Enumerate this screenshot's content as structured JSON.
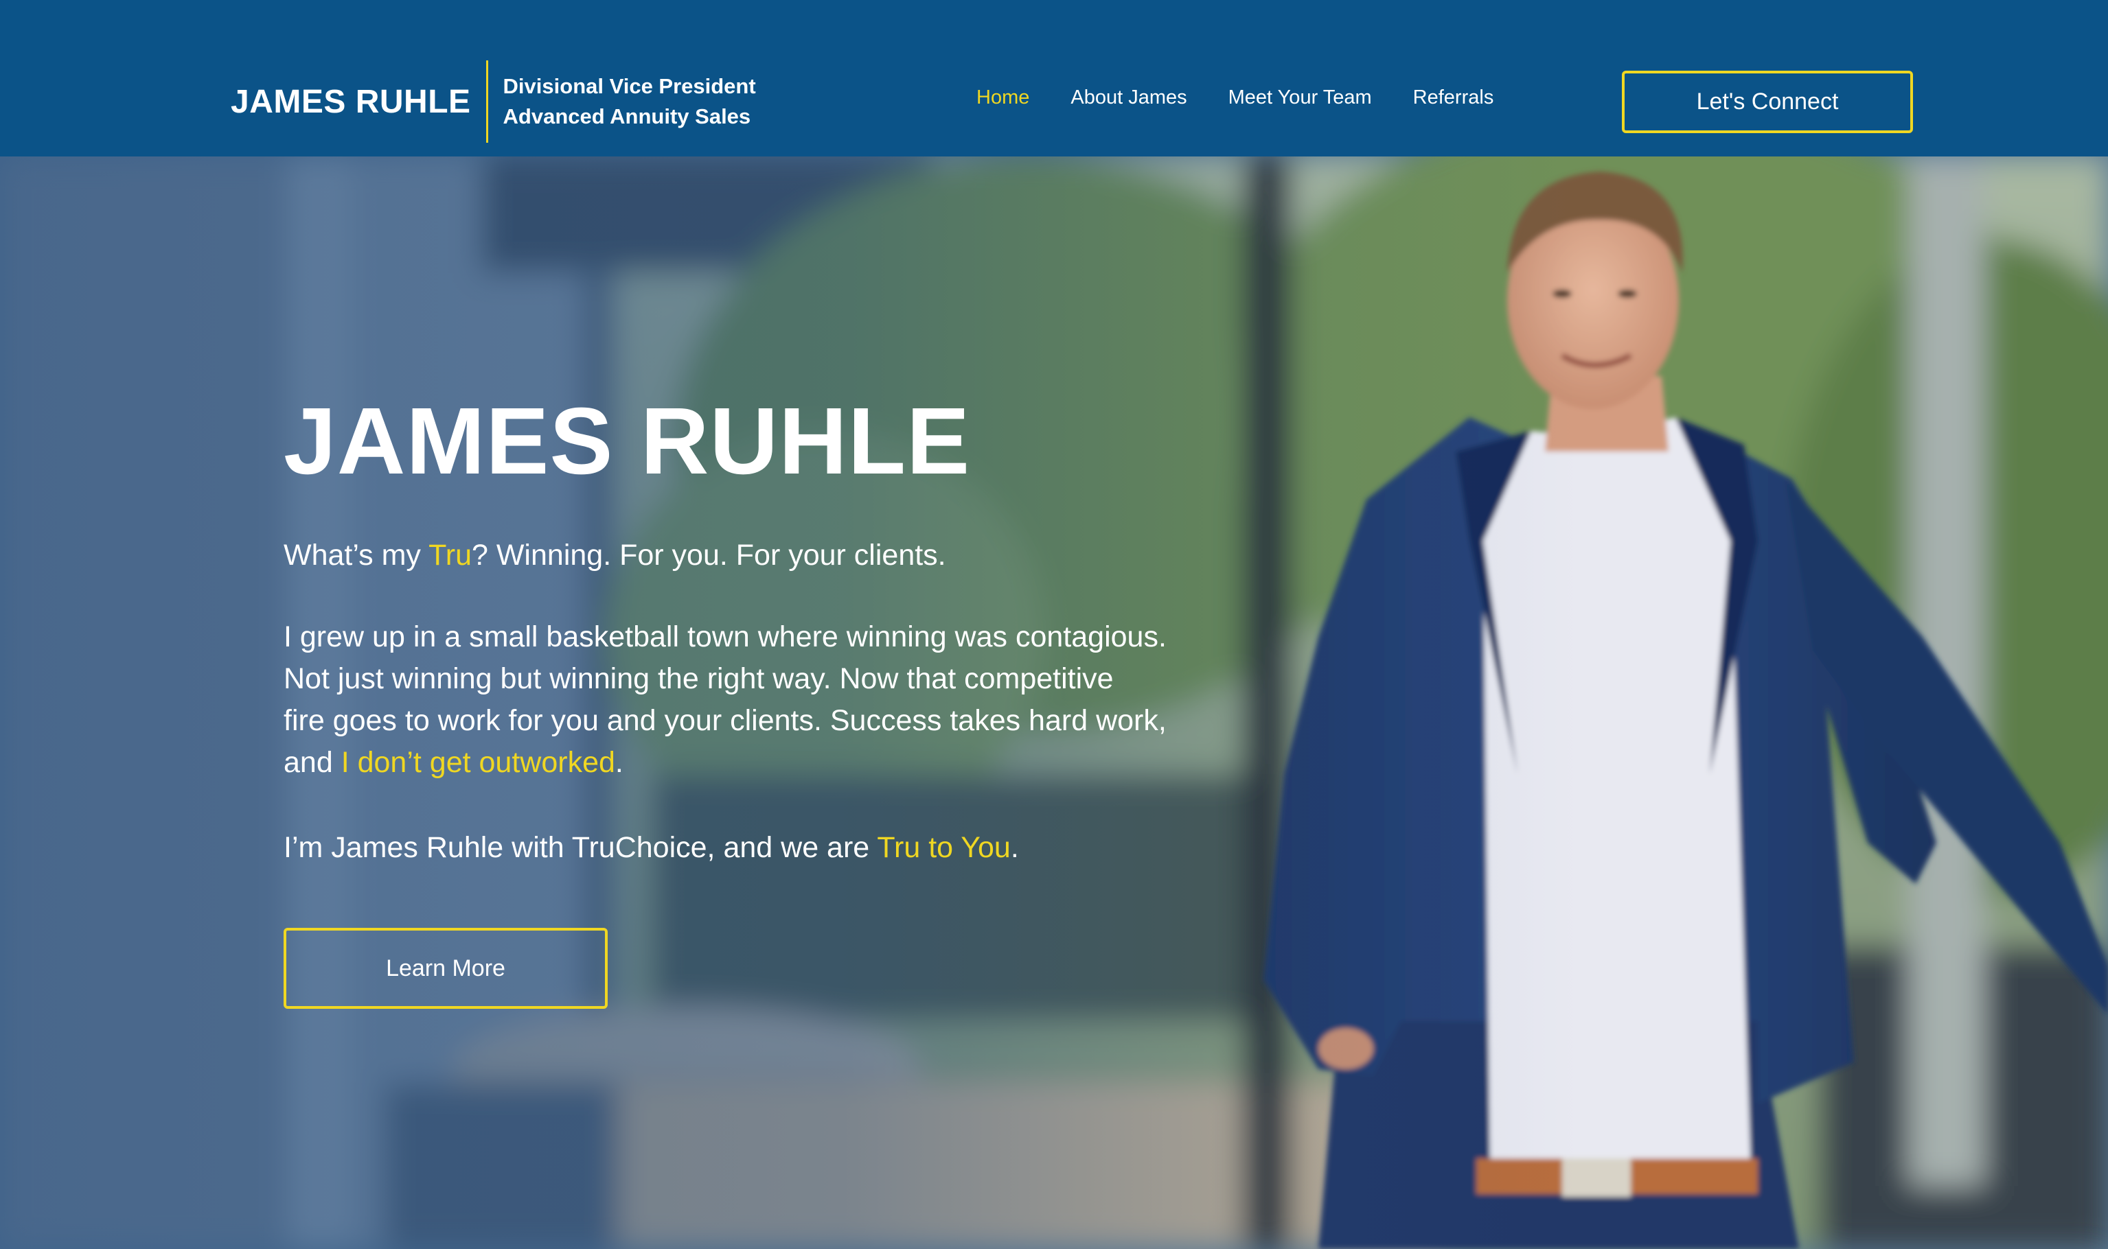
{
  "header": {
    "brand_name": "JAMES RUHLE",
    "title_line1": "Divisional Vice President",
    "title_line2": "Advanced Annuity Sales",
    "nav": [
      {
        "label": "Home",
        "active": true
      },
      {
        "label": "About James",
        "active": false
      },
      {
        "label": "Meet Your Team",
        "active": false
      },
      {
        "label": "Referrals",
        "active": false
      }
    ],
    "cta_label": "Let's Connect"
  },
  "hero": {
    "title": "JAMES RUHLE",
    "tagline": {
      "pre": "What’s my ",
      "highlight": "Tru",
      "post": "? Winning. For you. For your clients."
    },
    "paragraph": {
      "line1": "I grew up in a small basketball town where winning was contagious.",
      "line2": "Not just winning but winning the right way. Now that competitive",
      "line3": "fire goes to work for you and your clients. Success takes hard work,",
      "line4_pre": "and ",
      "line4_highlight": "I don’t get outworked",
      "line4_post": "."
    },
    "closing": {
      "pre": "I’m James Ruhle with TruChoice, and we are ",
      "highlight": "Tru to You",
      "post": "."
    },
    "button_label": "Learn More"
  },
  "colors": {
    "header_bg": "#0b5388",
    "accent": "#f0d722",
    "text": "#ffffff"
  }
}
